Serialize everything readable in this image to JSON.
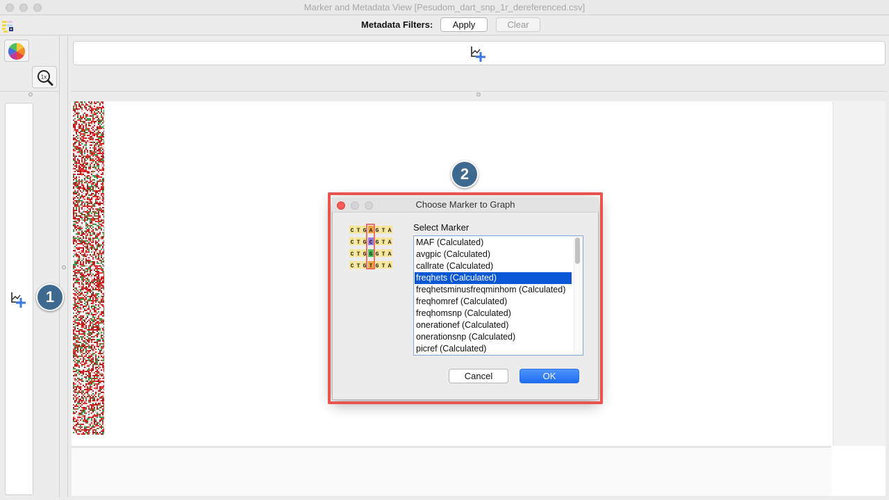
{
  "window": {
    "title": "Marker and Metadata View [Pesudom_dart_snp_1r_dereferenced.csv]"
  },
  "toolbar": {
    "filters_label": "Metadata Filters:",
    "apply_label": "Apply",
    "clear_label": "Clear"
  },
  "icons": {
    "app": "app-icon",
    "color_picker": "color-wheel-icon",
    "zoom": "zoom-1x-icon",
    "graph_add": "add-graph-icon",
    "zoom_text": "1x"
  },
  "callouts": {
    "one": "1",
    "two": "2",
    "color": "#3e6a8f"
  },
  "dialog": {
    "title": "Choose Marker to Graph",
    "select_label": "Select Marker",
    "cancel_label": "Cancel",
    "ok_label": "OK",
    "icon_letters": "CTGAGTA",
    "highlight_color": "#e8544e",
    "items": [
      "MAF (Calculated)",
      "avgpic (Calculated)",
      "callrate (Calculated)",
      "freqhets (Calculated)",
      "freqhetsminusfreqminhom (Calculated)",
      "freqhomref (Calculated)",
      "freqhomsnp (Calculated)",
      "onerationef (Calculated)",
      "onerationsnp (Calculated)",
      "picref (Calculated)"
    ],
    "selected_index": 3
  },
  "colors": {
    "selection": "#0a57d4",
    "ok_button": "#1f6ef2",
    "close_button": "#fc5b57"
  }
}
